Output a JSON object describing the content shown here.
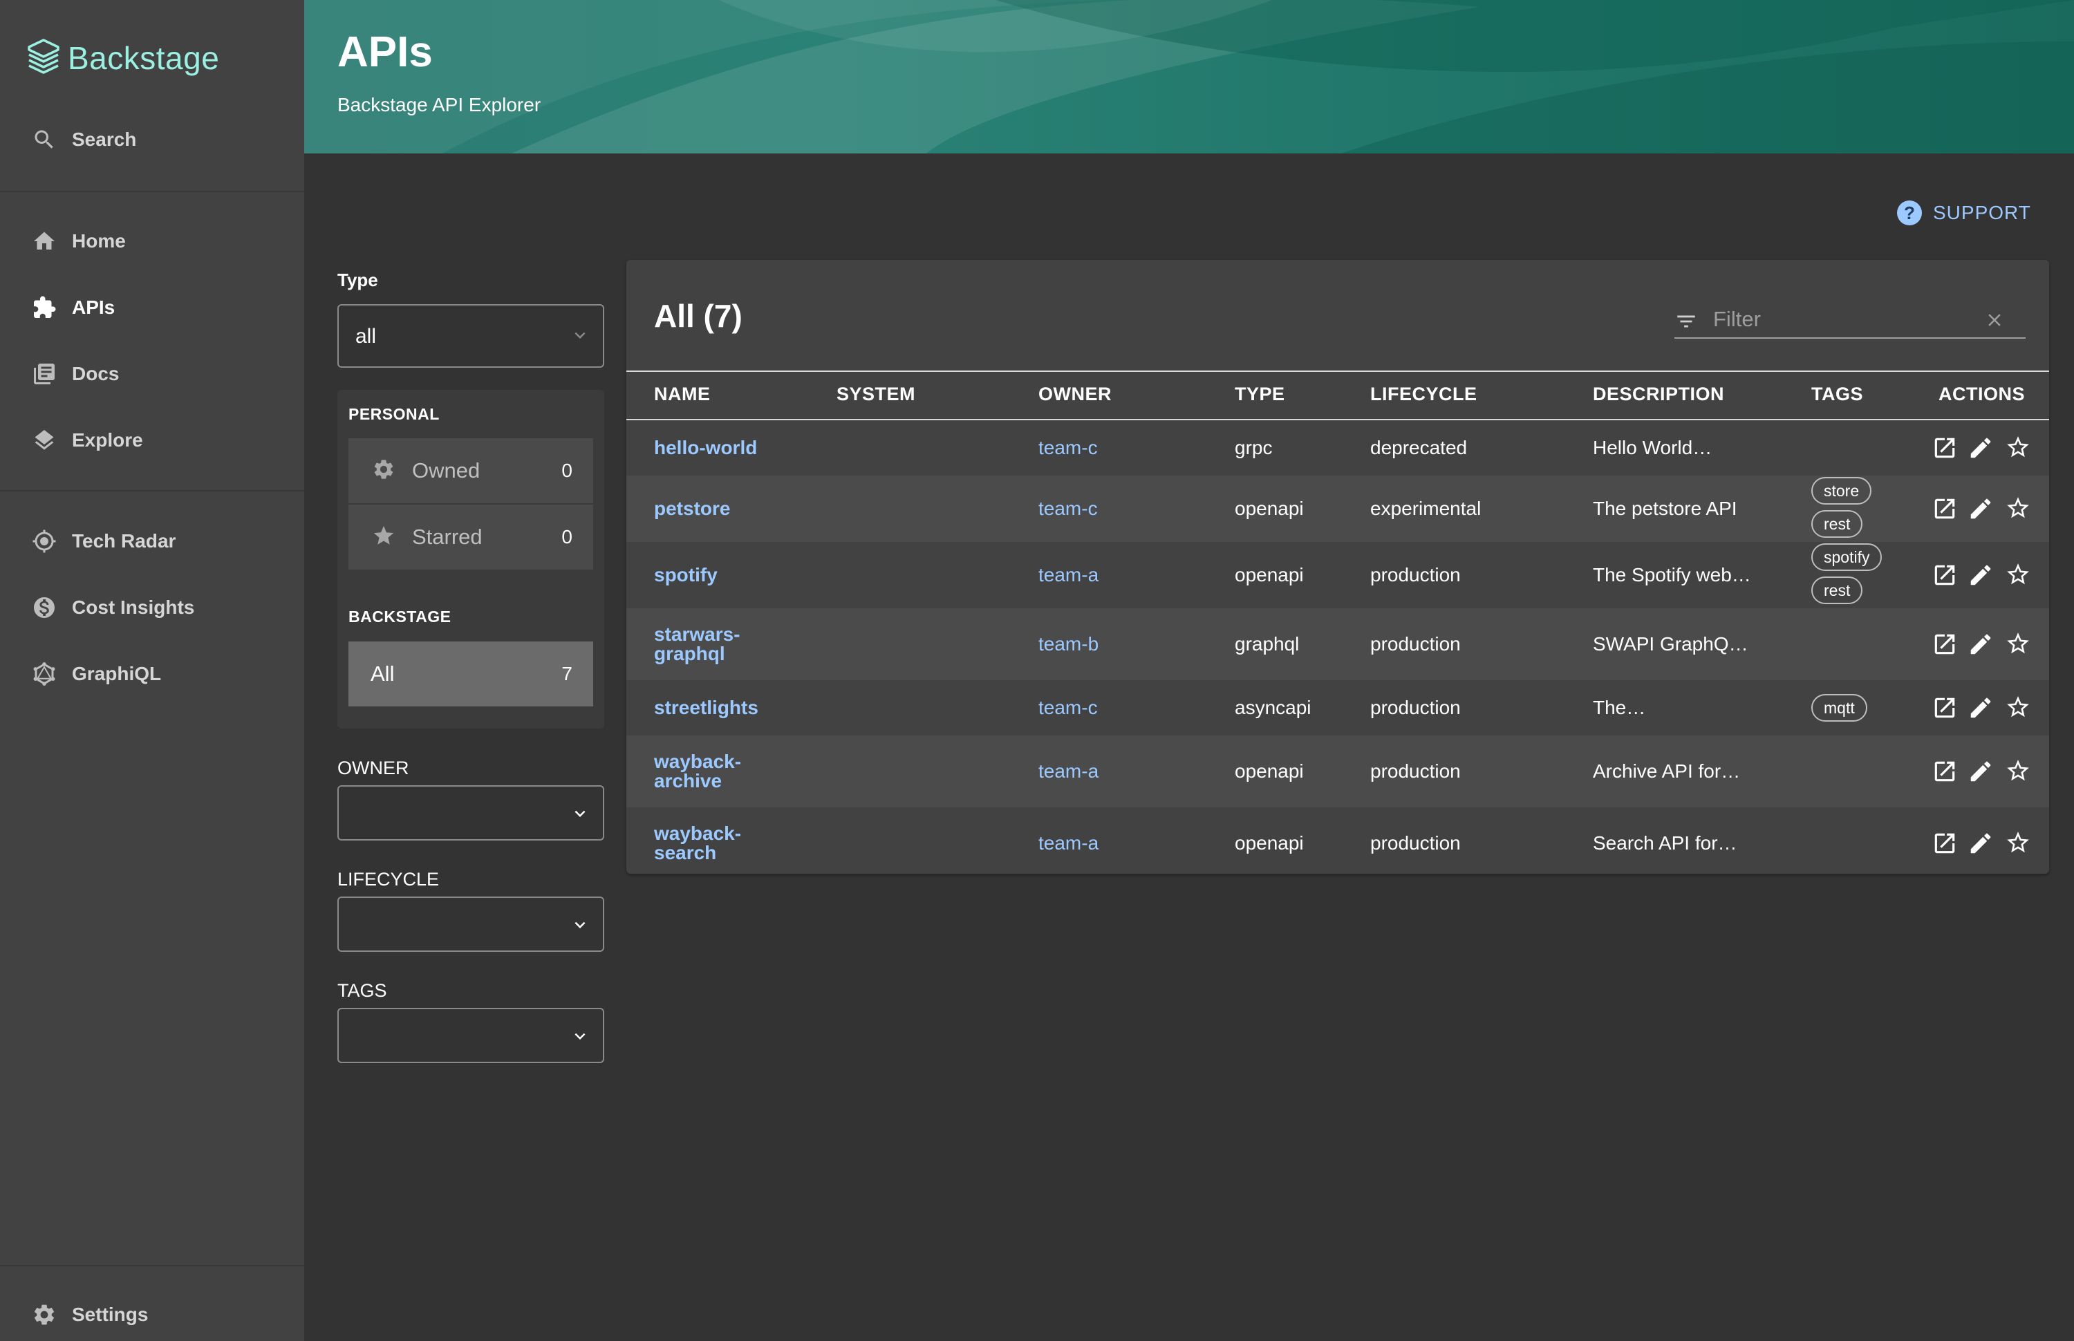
{
  "app": {
    "name": "Backstage"
  },
  "sidebar": {
    "search_label": "Search",
    "items": [
      {
        "label": "Home",
        "icon": "home-icon"
      },
      {
        "label": "APIs",
        "icon": "puzzle-icon",
        "active": true
      },
      {
        "label": "Docs",
        "icon": "library-icon"
      },
      {
        "label": "Explore",
        "icon": "layers-icon"
      },
      {
        "label": "Tech Radar",
        "icon": "gps-icon"
      },
      {
        "label": "Cost Insights",
        "icon": "money-icon"
      },
      {
        "label": "GraphiQL",
        "icon": "graphql-icon"
      }
    ],
    "settings_label": "Settings"
  },
  "header": {
    "title": "APIs",
    "subtitle": "Backstage API Explorer"
  },
  "support": {
    "label": "SUPPORT"
  },
  "filters": {
    "type": {
      "label": "Type",
      "value": "all"
    },
    "personal": {
      "heading": "PERSONAL",
      "owned": {
        "label": "Owned",
        "count": "0"
      },
      "starred": {
        "label": "Starred",
        "count": "0"
      }
    },
    "backstage": {
      "heading": "BACKSTAGE",
      "all": {
        "label": "All",
        "count": "7"
      }
    },
    "owner": {
      "label": "OWNER",
      "value": ""
    },
    "lifecycle": {
      "label": "LIFECYCLE",
      "value": ""
    },
    "tags": {
      "label": "TAGS",
      "value": ""
    }
  },
  "table": {
    "title": "All (7)",
    "filter_placeholder": "Filter",
    "columns": [
      "NAME",
      "SYSTEM",
      "OWNER",
      "TYPE",
      "LIFECYCLE",
      "DESCRIPTION",
      "TAGS",
      "ACTIONS"
    ],
    "rows": [
      {
        "name": [
          "hello-world"
        ],
        "system": "",
        "owner": "team-c",
        "type": "grpc",
        "lifecycle": "deprecated",
        "description": "Hello World…",
        "tags": []
      },
      {
        "name": [
          "petstore"
        ],
        "system": "",
        "owner": "team-c",
        "type": "openapi",
        "lifecycle": "experimental",
        "description": "The petstore API",
        "tags": [
          "store",
          "rest"
        ]
      },
      {
        "name": [
          "spotify"
        ],
        "system": "",
        "owner": "team-a",
        "type": "openapi",
        "lifecycle": "production",
        "description": "The Spotify web…",
        "tags": [
          "spotify",
          "rest"
        ]
      },
      {
        "name": [
          "starwars-",
          "graphql"
        ],
        "system": "",
        "owner": "team-b",
        "type": "graphql",
        "lifecycle": "production",
        "description": "SWAPI GraphQ…",
        "tags": []
      },
      {
        "name": [
          "streetlights"
        ],
        "system": "",
        "owner": "team-c",
        "type": "asyncapi",
        "lifecycle": "production",
        "description": "The…",
        "tags": [
          "mqtt"
        ]
      },
      {
        "name": [
          "wayback-",
          "archive"
        ],
        "system": "",
        "owner": "team-a",
        "type": "openapi",
        "lifecycle": "production",
        "description": "Archive API for…",
        "tags": []
      },
      {
        "name": [
          "wayback-",
          "search"
        ],
        "system": "",
        "owner": "team-a",
        "type": "openapi",
        "lifecycle": "production",
        "description": "Search API for…",
        "tags": []
      }
    ]
  }
}
